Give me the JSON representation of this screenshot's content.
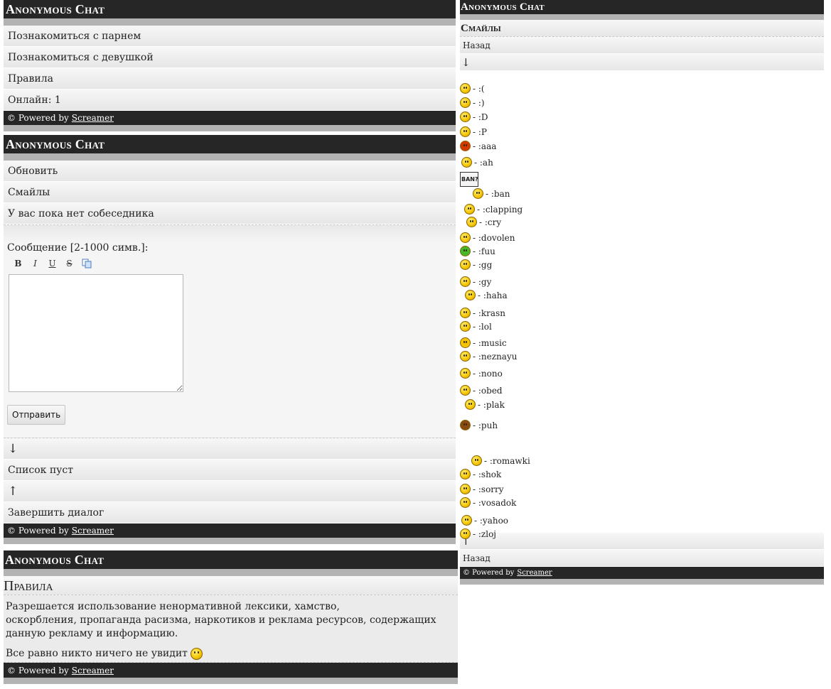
{
  "app_title": "Anonymous Chat",
  "footer": {
    "prefix": "© Powered by",
    "link": "Screamer"
  },
  "home": {
    "items": [
      "Познакомиться с парнем",
      "Познакомиться с девушкой",
      "Правила"
    ],
    "online": "Онлайн: 1"
  },
  "chat": {
    "refresh": "Обновить",
    "smileys": "Смайлы",
    "status": "У вас пока нет собеседника",
    "message_label": "Сообщение [2-1000 симв.]:",
    "toolbar": {
      "bold": "B",
      "italic": "I",
      "underline": "U",
      "strike": "S"
    },
    "send": "Отправить",
    "down_arrow": "↓",
    "list_empty": "Список пуст",
    "up_arrow": "↑",
    "end": "Завершить диалог"
  },
  "rules": {
    "title": "Правила",
    "line1": "Разрешается использование ненормативной лексики, хамство,",
    "line2": "оскорбления, пропаганда расизма, наркотиков и реклама ресурсов, содержащих данную рекламу и информацию.",
    "line3": "Все равно никто ничего не увидит"
  },
  "smileys_page": {
    "title": "Смайлы",
    "back": "Назад",
    "down_arrow": "↓",
    "up_arrow": "↑",
    "ban_sign": "BAN?",
    "items": [
      ":(",
      ":)",
      ":D",
      ":P",
      ":aaa",
      ":ah",
      ":ban",
      ":clapping",
      ":cry",
      ":dovolen",
      ":fuu",
      ":gg",
      ":gy",
      ":haha",
      ":krasn",
      ":lol",
      ":music",
      ":neznayu",
      ":nono",
      ":obed",
      ":plak",
      ":puh",
      ":romawki",
      ":shok",
      ":sorry",
      ":vosadok",
      ":yahoo",
      ":zloj"
    ]
  }
}
